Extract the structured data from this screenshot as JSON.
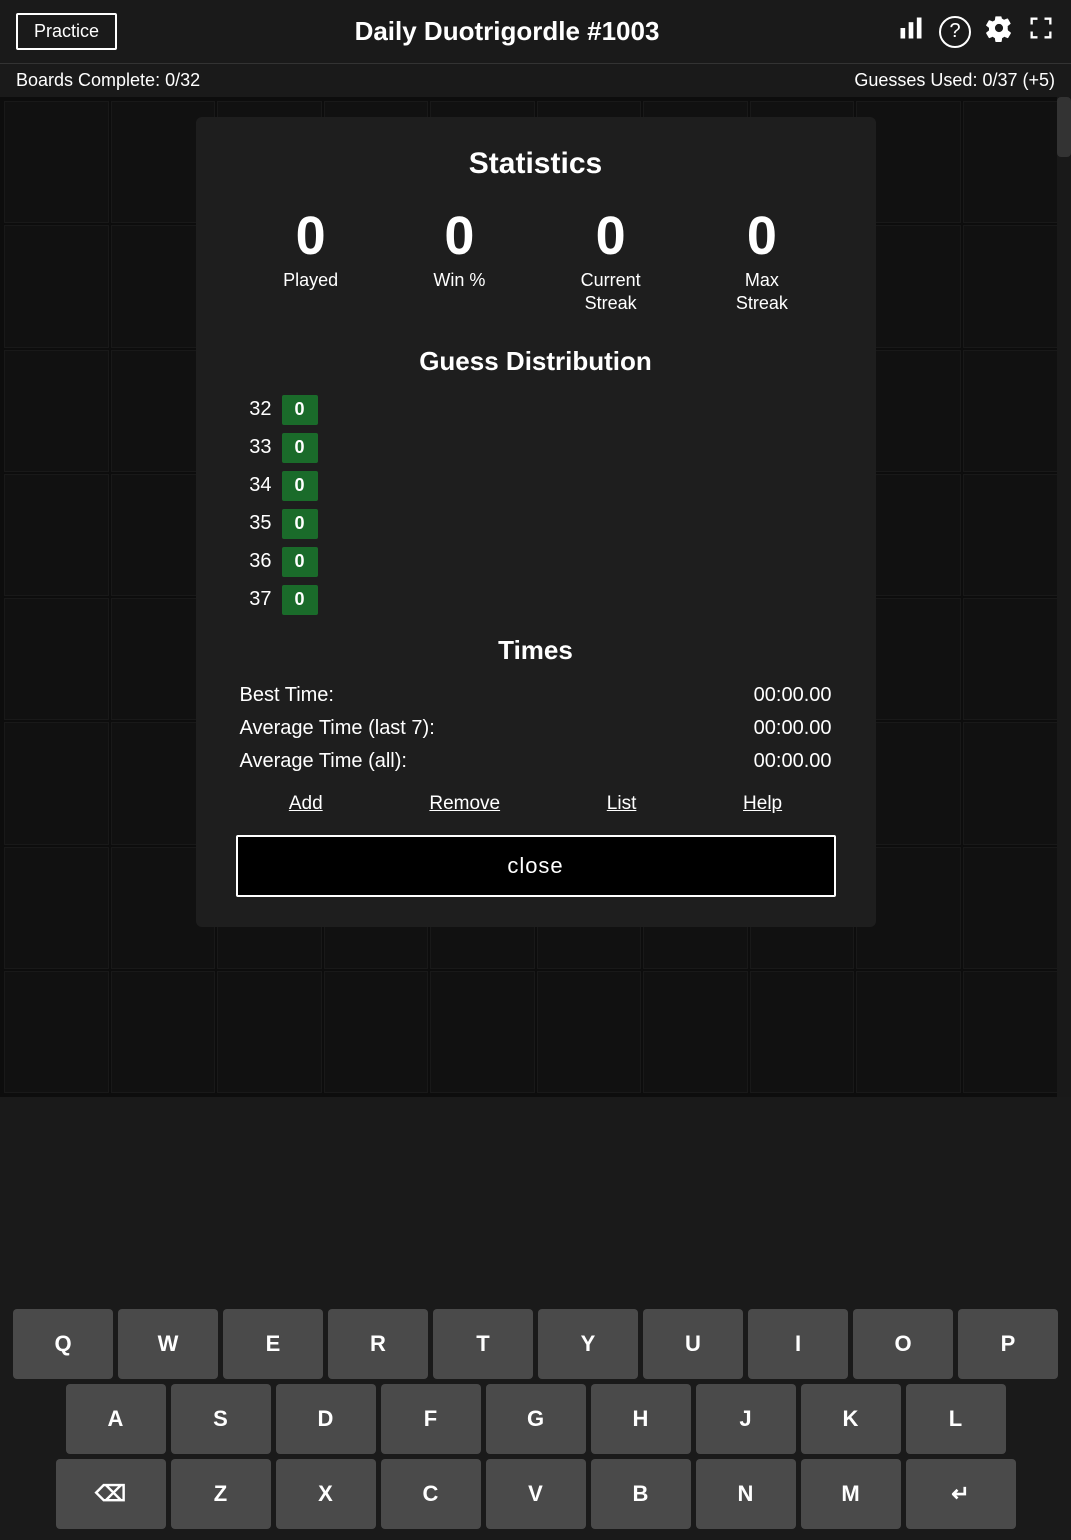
{
  "header": {
    "practice_label": "Practice",
    "title": "Daily Duotrigordle #1003",
    "stats_icon": "📊",
    "help_icon": "?",
    "settings_icon": "⚙",
    "expand_icon": "⛶"
  },
  "status": {
    "boards_complete": "Boards Complete: 0/32",
    "guesses_used": "Guesses Used: 0/37 (+5)"
  },
  "modal": {
    "title": "Statistics",
    "stats": [
      {
        "number": "0",
        "label": "Played"
      },
      {
        "number": "0",
        "label": "Win %"
      },
      {
        "number": "0",
        "label": "Current\nStreak"
      },
      {
        "number": "0",
        "label": "Max\nStreak"
      }
    ],
    "distribution_title": "Guess Distribution",
    "distribution": [
      {
        "label": "32",
        "value": "0"
      },
      {
        "label": "33",
        "value": "0"
      },
      {
        "label": "34",
        "value": "0"
      },
      {
        "label": "35",
        "value": "0"
      },
      {
        "label": "36",
        "value": "0"
      },
      {
        "label": "37",
        "value": "0"
      }
    ],
    "times_title": "Times",
    "times": [
      {
        "label": "Best Time:",
        "value": "00:00.00"
      },
      {
        "label": "Average Time (last 7):",
        "value": "00:00.00"
      },
      {
        "label": "Average Time (all):",
        "value": "00:00.00"
      }
    ],
    "links": [
      "Add",
      "Remove",
      "List",
      "Help"
    ],
    "close_label": "close"
  },
  "keyboard": {
    "row1": [
      "Q",
      "W",
      "E",
      "R",
      "T",
      "Y",
      "U",
      "I",
      "O",
      "P"
    ],
    "row2": [
      "A",
      "S",
      "D",
      "F",
      "G",
      "H",
      "J",
      "K",
      "L"
    ],
    "row3_start": "⌫",
    "row3_mid": [
      "Z",
      "X",
      "C",
      "V",
      "B",
      "N",
      "M"
    ],
    "row3_end": "↵"
  }
}
